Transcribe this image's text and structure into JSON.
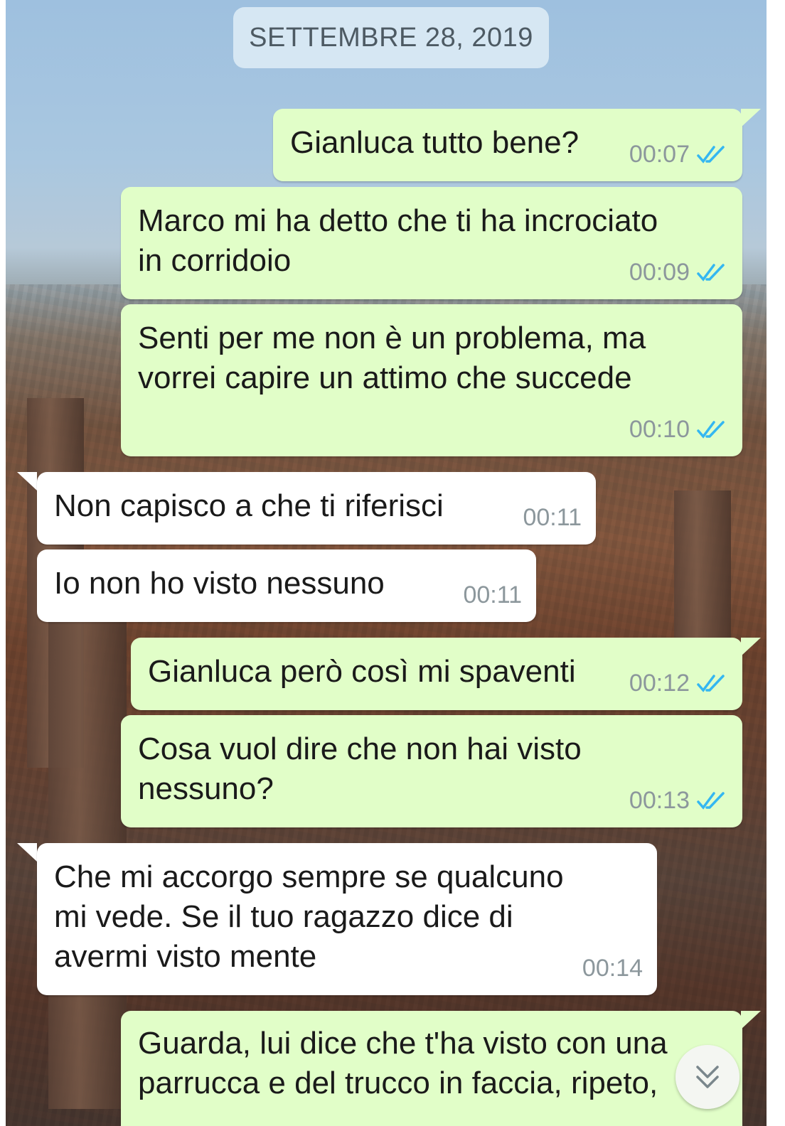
{
  "date_chip": "SETTEMBRE 28, 2019",
  "colors": {
    "outgoing": "#e1fec8",
    "incoming": "#ffffff",
    "read_tick": "#34b7f1"
  },
  "messages": [
    {
      "text": "Gianluca tutto bene?",
      "time": "00:07",
      "direction": "outgoing",
      "read": true
    },
    {
      "text": "Marco mi ha detto che ti ha incrociato\nin corridoio",
      "time": "00:09",
      "direction": "outgoing",
      "read": true
    },
    {
      "text": "Senti per me non è un problema, ma\nvorrei capire un attimo che succede",
      "time": "00:10",
      "direction": "outgoing",
      "read": true
    },
    {
      "text": "Non capisco a che ti riferisci",
      "time": "00:11",
      "direction": "incoming"
    },
    {
      "text": "Io non ho visto nessuno",
      "time": "00:11",
      "direction": "incoming"
    },
    {
      "text": "Gianluca però così mi spaventi",
      "time": "00:12",
      "direction": "outgoing",
      "read": true
    },
    {
      "text": "Cosa vuol dire che non hai visto\nnessuno?",
      "time": "00:13",
      "direction": "outgoing",
      "read": true
    },
    {
      "text": "Che mi accorgo sempre se qualcuno\nmi vede. Se il tuo ragazzo dice di\navermi visto mente",
      "time": "00:14",
      "direction": "incoming"
    },
    {
      "text": "Guarda, lui dice che t'ha visto con una\nparrucca e del trucco in faccia, ripeto,",
      "time": "",
      "direction": "outgoing"
    }
  ],
  "scroll_down_icon": "double-chevron-down-icon"
}
